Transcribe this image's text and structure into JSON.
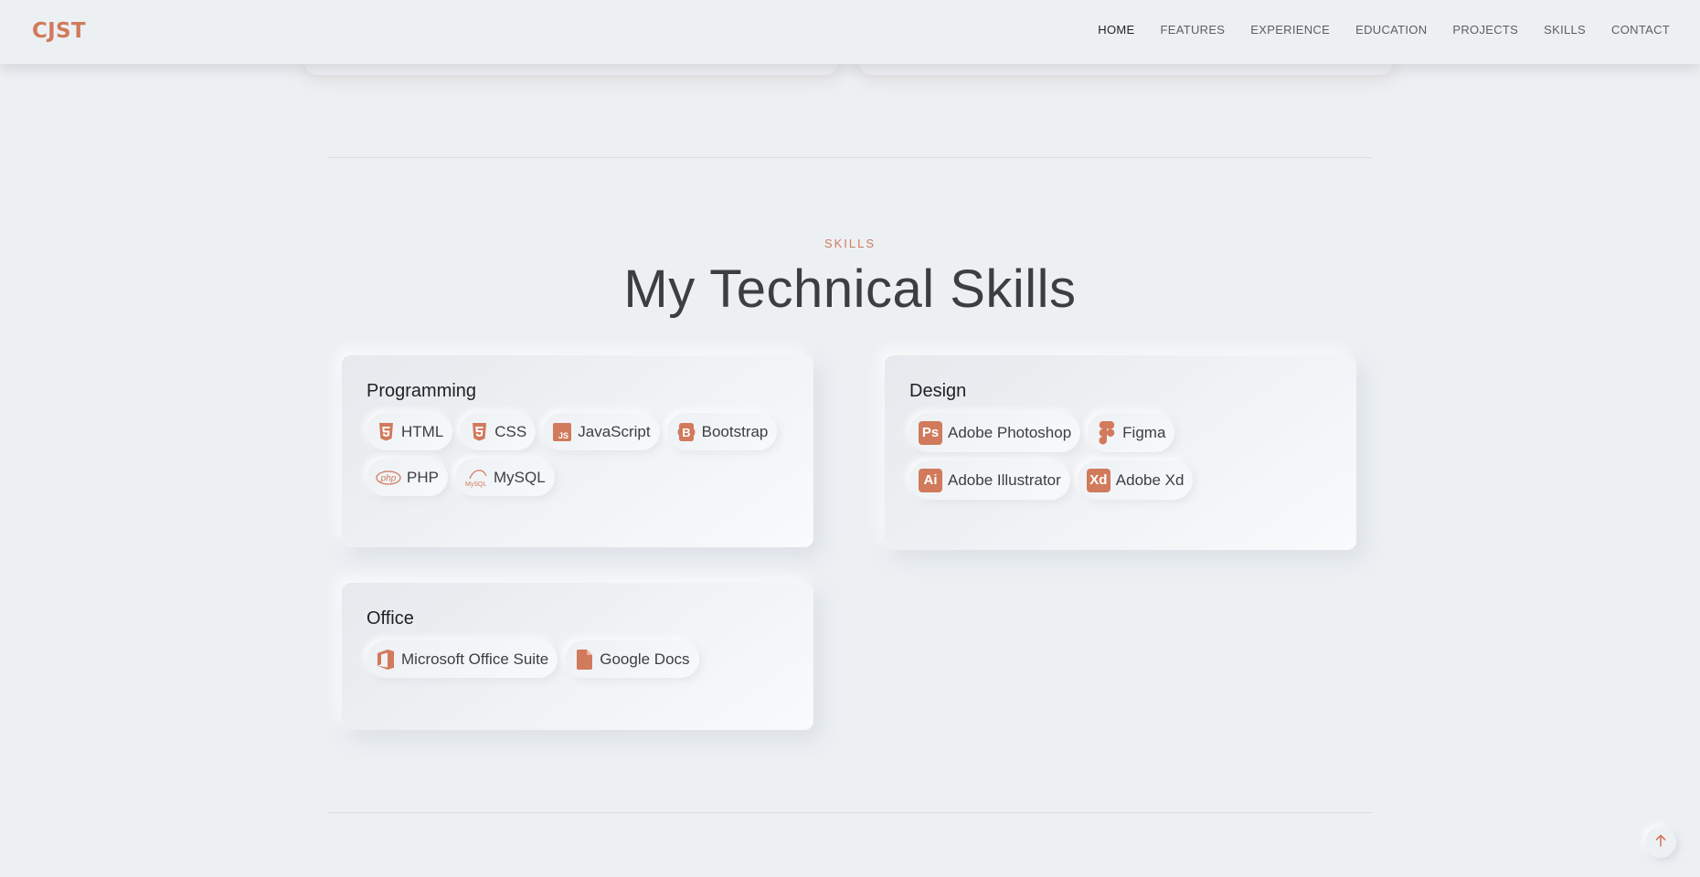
{
  "brand": {
    "logo": "CJST",
    "accent": "#d17a5c"
  },
  "nav": {
    "items": [
      {
        "label": "HOME",
        "active": true
      },
      {
        "label": "FEATURES",
        "active": false
      },
      {
        "label": "EXPERIENCE",
        "active": false
      },
      {
        "label": "EDUCATION",
        "active": false
      },
      {
        "label": "PROJECTS",
        "active": false
      },
      {
        "label": "SKILLS",
        "active": false
      },
      {
        "label": "CONTACT",
        "active": false
      }
    ]
  },
  "skills_section": {
    "kicker": "SKILLS",
    "title": "My Technical Skills",
    "categories": [
      {
        "title": "Programming",
        "items": [
          {
            "label": "HTML",
            "icon": "html5-icon"
          },
          {
            "label": "CSS",
            "icon": "css3-icon"
          },
          {
            "label": "JavaScript",
            "icon": "javascript-icon"
          },
          {
            "label": "Bootstrap",
            "icon": "bootstrap-icon"
          },
          {
            "label": "PHP",
            "icon": "php-icon"
          },
          {
            "label": "MySQL",
            "icon": "mysql-icon"
          }
        ]
      },
      {
        "title": "Design",
        "items": [
          {
            "label": "Adobe Photoshop",
            "icon": "photoshop-icon",
            "badge": "Ps"
          },
          {
            "label": "Figma",
            "icon": "figma-icon"
          },
          {
            "label": "Adobe Illustrator",
            "icon": "illustrator-icon",
            "badge": "Ai"
          },
          {
            "label": "Adobe Xd",
            "icon": "xd-icon",
            "badge": "Xd"
          }
        ]
      },
      {
        "title": "Office",
        "items": [
          {
            "label": "Microsoft Office Suite",
            "icon": "office-icon"
          },
          {
            "label": "Google Docs",
            "icon": "document-icon"
          }
        ]
      }
    ]
  },
  "icons": {
    "js_text": "JS",
    "bootstrap_text": "B",
    "php_text": "php",
    "mysql_text": "MySQL",
    "back_to_top": "arrow-up-icon"
  }
}
